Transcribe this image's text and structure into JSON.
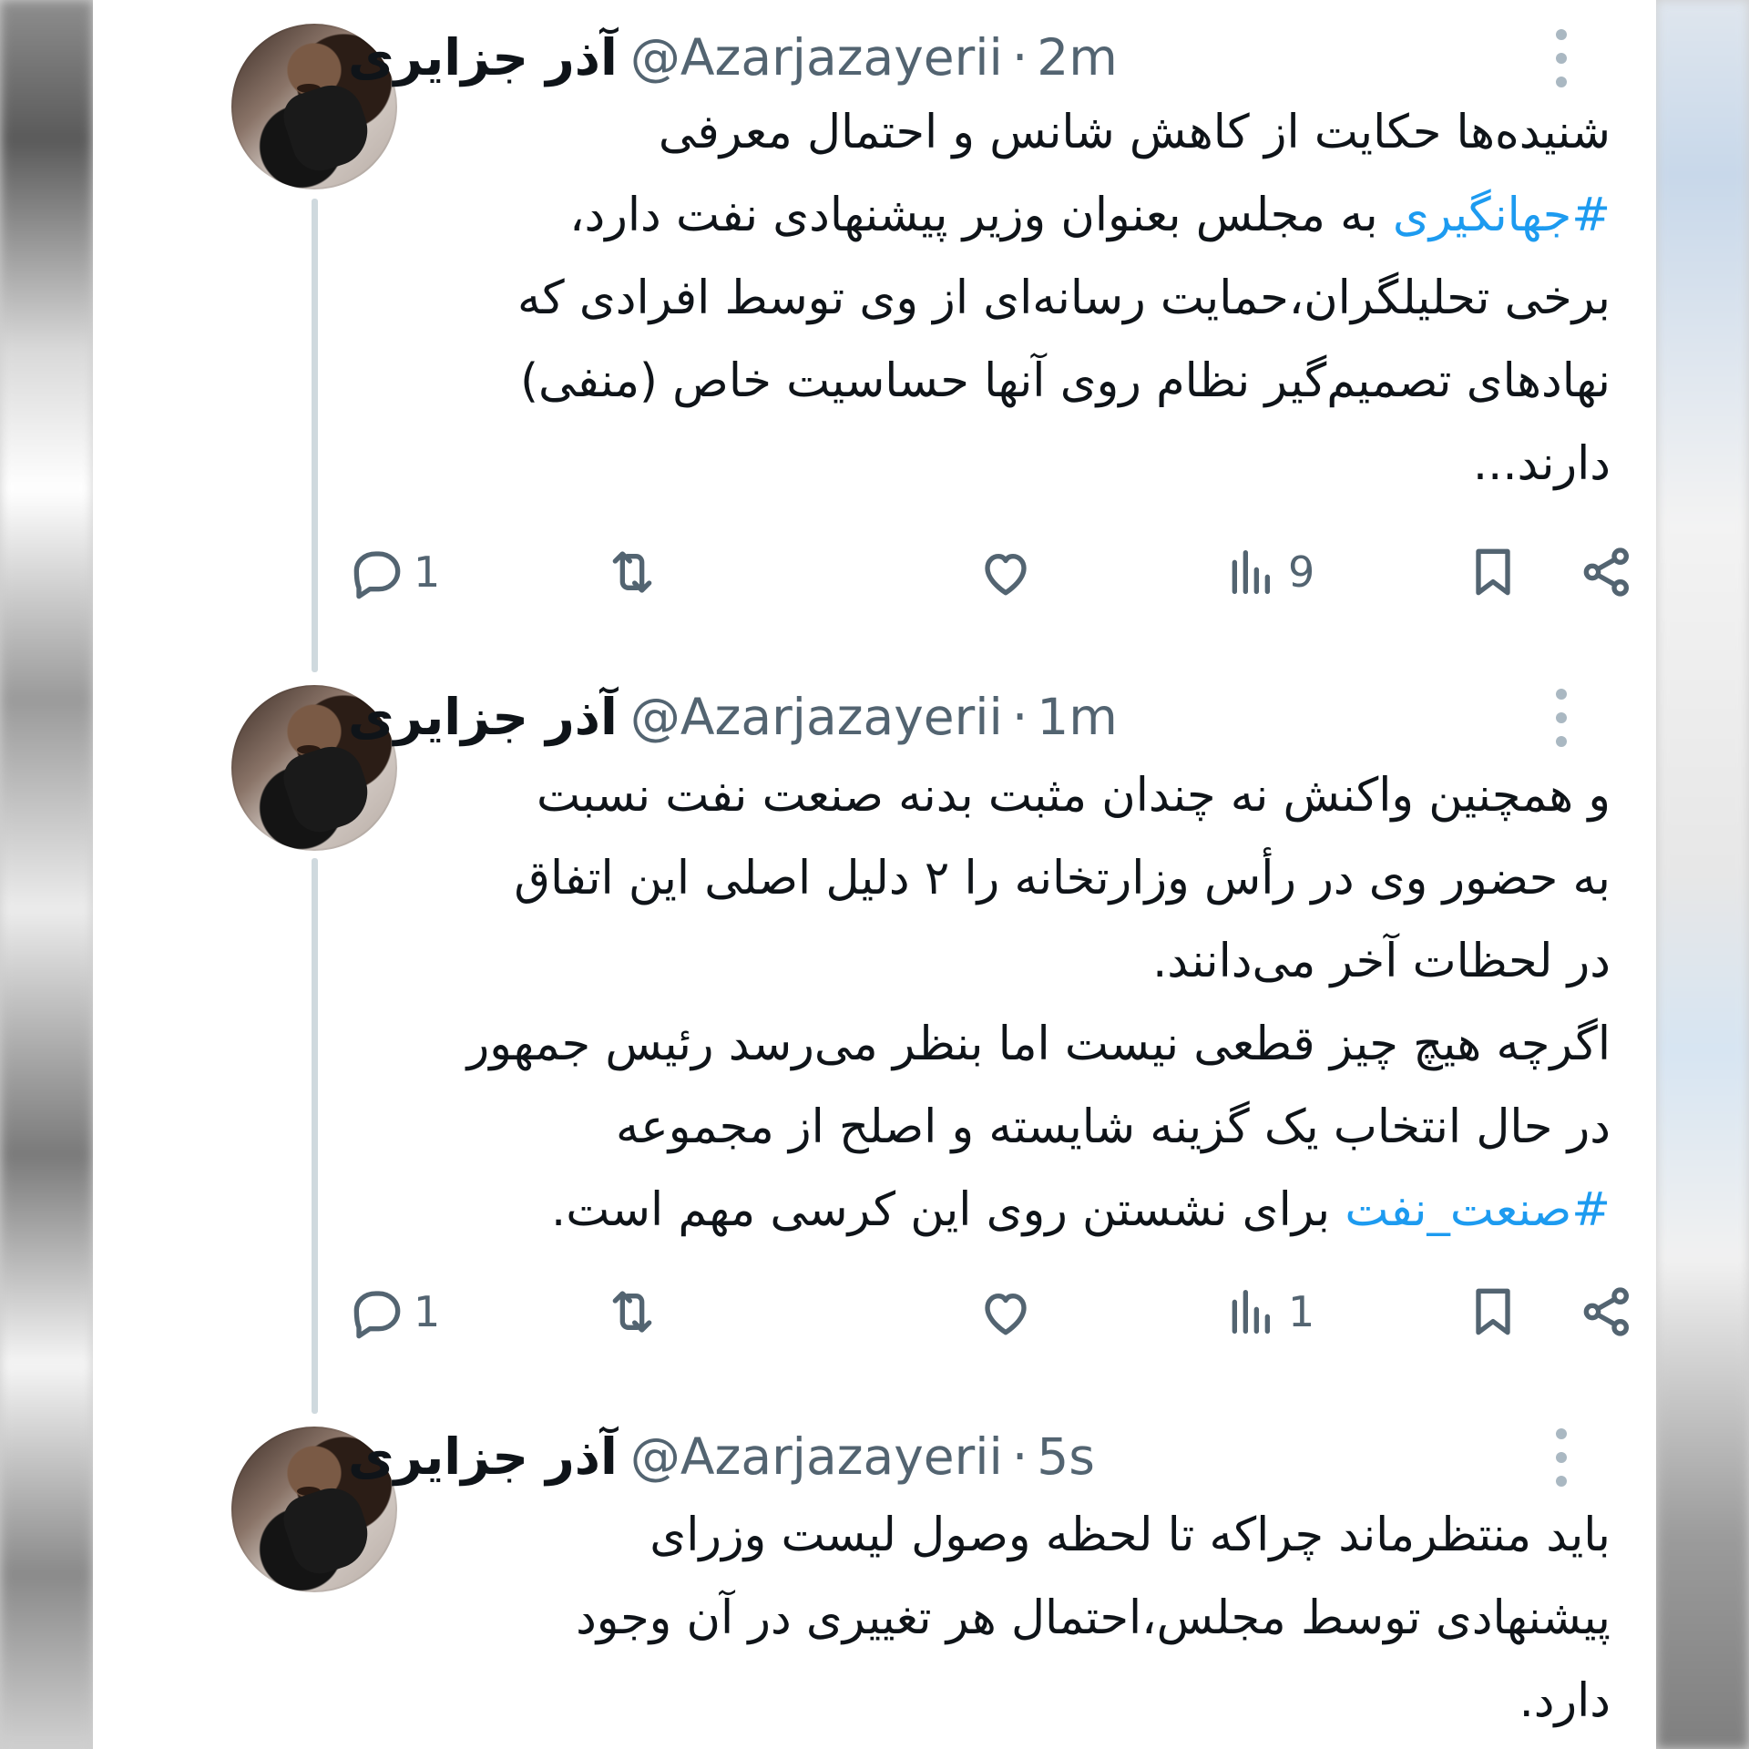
{
  "tweets": [
    {
      "name": "آذر جزایری",
      "handle": "@Azarjazayerii",
      "time": "2m",
      "lines": [
        {
          "text": "شنیده‌ها حکایت از کاهش شانس و احتمال معرفی"
        },
        {
          "hashtag": "#جهانگیری",
          "text": " به مجلس بعنوان وزیر پیشنهادی نفت دارد،"
        },
        {
          "text": "برخی تحلیلگران،حمایت رسانه‌ای از وی توسط افرادی که"
        },
        {
          "text": "نهادهای تصمیم‌گیر نظام روی آنها حساسیت خاص (منفی)"
        },
        {
          "text": "دارند..."
        }
      ],
      "replies": "1",
      "retweets": "",
      "likes": "",
      "views": "9"
    },
    {
      "name": "آذر جزایری",
      "handle": "@Azarjazayerii",
      "time": "1m",
      "lines": [
        {
          "text": "و همچنین واکنش نه چندان مثبت بدنه صنعت نفت نسبت"
        },
        {
          "text": "به حضور وی در رأس وزارتخانه را ۲ دلیل اصلی این اتفاق"
        },
        {
          "text": "در لحظات آخر می‌دانند."
        },
        {
          "text": "اگرچه هیچ چیز قطعی نیست اما بنظر می‌رسد رئیس جمهور"
        },
        {
          "text": "در حال انتخاب یک گزینه شایسته و اصلح از مجموعه"
        },
        {
          "hashtag": "#صنعت_نفت",
          "text": " برای نشستن روی این کرسی مهم است."
        }
      ],
      "replies": "1",
      "retweets": "",
      "likes": "",
      "views": "1"
    },
    {
      "name": "آذر جزایری",
      "handle": "@Azarjazayerii",
      "time": "5s",
      "lines": [
        {
          "text": "باید منتظرماند چراکه تا لحظه وصول لیست وزرای"
        },
        {
          "text": "پیشنهادی توسط مجلس،احتمال هر تغییری در آن وجود"
        },
        {
          "text": "دارد."
        }
      ]
    }
  ],
  "separator": "·",
  "icons": [
    "reply-icon",
    "retweet-icon",
    "like-icon",
    "views-icon",
    "bookmark-icon",
    "share-icon",
    "more-icon"
  ],
  "colors": {
    "hashtag": "#1d9bf0",
    "muted": "#536471",
    "text": "#0f1419",
    "thread": "#cfd9de"
  }
}
